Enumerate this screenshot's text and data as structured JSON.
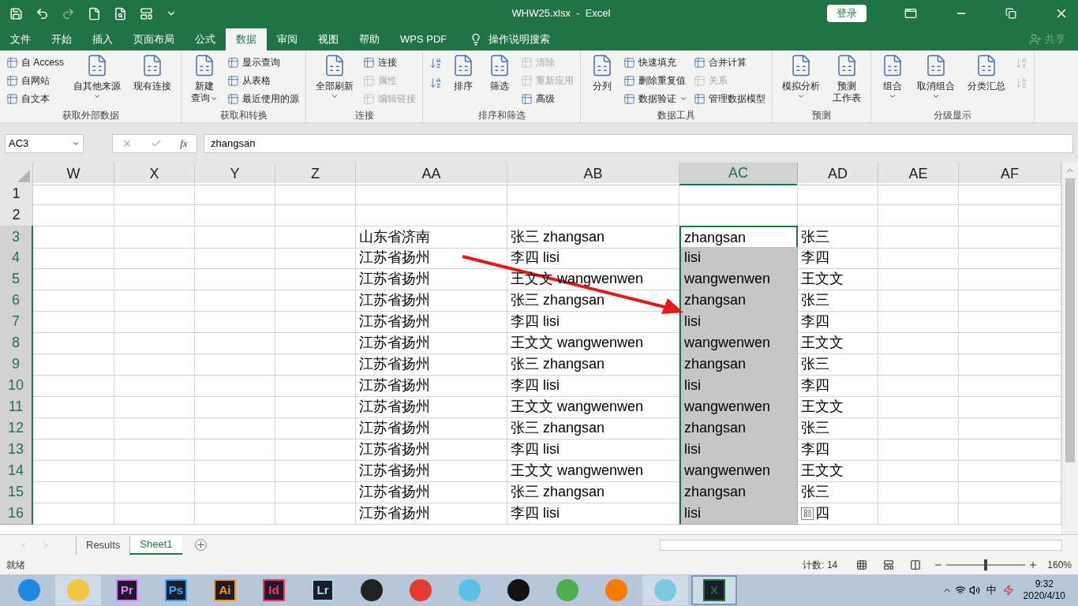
{
  "window": {
    "title": "WHW25.xlsx  -  Excel",
    "login": "登录"
  },
  "tabs": [
    {
      "label": "文件",
      "selected": false
    },
    {
      "label": "开始",
      "selected": false
    },
    {
      "label": "插入",
      "selected": false
    },
    {
      "label": "页面布局",
      "selected": false
    },
    {
      "label": "公式",
      "selected": false
    },
    {
      "label": "数据",
      "selected": true
    },
    {
      "label": "审阅",
      "selected": false
    },
    {
      "label": "视图",
      "selected": false
    },
    {
      "label": "帮助",
      "selected": false
    },
    {
      "label": "WPS PDF",
      "selected": false
    }
  ],
  "tell_me": "操作说明搜索",
  "share": "共享",
  "ribbon_groups": [
    {
      "title": "获取外部数据",
      "columns": [
        [
          {
            "kind": "small",
            "label": "自 Access",
            "disabled": false
          },
          {
            "kind": "small",
            "label": "自网站",
            "disabled": false
          },
          {
            "kind": "small",
            "label": "自文本",
            "disabled": false
          }
        ],
        [
          {
            "kind": "large",
            "label": "自其他来源",
            "dropdown": true,
            "disabled": false
          }
        ],
        [
          {
            "kind": "large",
            "label": "现有连接",
            "dropdown": false,
            "disabled": false
          }
        ]
      ]
    },
    {
      "title": "获取和转换",
      "columns": [
        [
          {
            "kind": "large",
            "lines": [
              "新建",
              "查询"
            ],
            "dropdown": true,
            "disabled": false
          }
        ],
        [
          {
            "kind": "small",
            "label": "显示查询",
            "disabled": false
          },
          {
            "kind": "small",
            "label": "从表格",
            "disabled": false
          },
          {
            "kind": "small",
            "label": "最近使用的源",
            "disabled": false
          }
        ]
      ]
    },
    {
      "title": "连接",
      "columns": [
        [
          {
            "kind": "large",
            "label": "全部刷新",
            "dropdown": true,
            "disabled": false
          }
        ],
        [
          {
            "kind": "small",
            "label": "连接",
            "disabled": false
          },
          {
            "kind": "small",
            "label": "属性",
            "disabled": true
          },
          {
            "kind": "small",
            "label": "编辑链接",
            "disabled": true
          }
        ]
      ]
    },
    {
      "title": "排序和筛选",
      "columns": [
        [
          {
            "kind": "icon",
            "disabled": false
          },
          {
            "kind": "icon",
            "disabled": false
          }
        ],
        [
          {
            "kind": "large",
            "label": "排序",
            "dropdown": false,
            "disabled": false
          }
        ],
        [
          {
            "kind": "large",
            "label": "筛选",
            "dropdown": false,
            "disabled": false
          }
        ],
        [
          {
            "kind": "small",
            "label": "清除",
            "disabled": true
          },
          {
            "kind": "small",
            "label": "重新应用",
            "disabled": true
          },
          {
            "kind": "small",
            "label": "高级",
            "disabled": false
          }
        ]
      ]
    },
    {
      "title": "数据工具",
      "columns": [
        [
          {
            "kind": "large",
            "label": "分列",
            "dropdown": false,
            "disabled": false
          }
        ],
        [
          {
            "kind": "small",
            "label": "快速填充",
            "disabled": false
          },
          {
            "kind": "small",
            "label": "删除重复值",
            "disabled": false
          },
          {
            "kind": "small",
            "label": "数据验证",
            "disabled": false,
            "dropdown": true
          }
        ],
        [
          {
            "kind": "small",
            "label": "合并计算",
            "disabled": false
          },
          {
            "kind": "small",
            "label": "关系",
            "disabled": true
          },
          {
            "kind": "small",
            "label": "管理数据模型",
            "disabled": false
          }
        ]
      ]
    },
    {
      "title": "预测",
      "columns": [
        [
          {
            "kind": "large",
            "label": "模拟分析",
            "dropdown": true,
            "disabled": false
          }
        ],
        [
          {
            "kind": "large",
            "lines": [
              "预测",
              "工作表"
            ],
            "dropdown": false,
            "disabled": false
          }
        ]
      ]
    },
    {
      "title": "分级显示",
      "columns": [
        [
          {
            "kind": "large",
            "label": "组合",
            "dropdown": true,
            "disabled": false
          }
        ],
        [
          {
            "kind": "large",
            "label": "取消组合",
            "dropdown": true,
            "disabled": false
          }
        ],
        [
          {
            "kind": "large",
            "label": "分类汇总",
            "dropdown": false,
            "disabled": false
          }
        ],
        [
          {
            "kind": "icon",
            "disabled": true
          },
          {
            "kind": "icon",
            "disabled": true
          }
        ]
      ]
    }
  ],
  "formula_bar": {
    "name_box": "AC3",
    "fx": "fx",
    "value": "zhangsan"
  },
  "columns": [
    {
      "label": "W",
      "selected": false
    },
    {
      "label": "X",
      "selected": false
    },
    {
      "label": "Y",
      "selected": false
    },
    {
      "label": "Z",
      "selected": false
    },
    {
      "label": "AA",
      "selected": false
    },
    {
      "label": "AB",
      "selected": false
    },
    {
      "label": "AC",
      "selected": true
    },
    {
      "label": "AD",
      "selected": false
    },
    {
      "label": "AE",
      "selected": false
    },
    {
      "label": "AF",
      "selected": false
    }
  ],
  "rows": [
    {
      "number": "1",
      "selected": false,
      "cells": [
        {
          "selected": false
        },
        {
          "selected": false
        },
        {
          "selected": false
        },
        {
          "selected": false
        },
        {
          "selected": false
        },
        {
          "selected": false
        },
        {
          "selected": false,
          "active": false
        },
        {
          "selected": false
        },
        {
          "selected": false
        },
        {
          "selected": false
        }
      ]
    },
    {
      "number": "2",
      "selected": false,
      "cells": [
        {
          "selected": false
        },
        {
          "selected": false
        },
        {
          "selected": false
        },
        {
          "selected": false
        },
        {
          "selected": false
        },
        {
          "selected": false
        },
        {
          "selected": false,
          "active": false
        },
        {
          "selected": false
        },
        {
          "selected": false
        },
        {
          "selected": false
        }
      ]
    },
    {
      "number": "3",
      "selected": true,
      "cells": [
        {
          "selected": false
        },
        {
          "selected": false
        },
        {
          "selected": false
        },
        {
          "selected": false
        },
        {
          "text": "山东省济南",
          "selected": false
        },
        {
          "text": "张三 zhangsan",
          "selected": false
        },
        {
          "text": "zhangsan",
          "selected": true,
          "active": true
        },
        {
          "text": "张三",
          "selected": false
        },
        {
          "selected": false
        },
        {
          "selected": false
        }
      ]
    },
    {
      "number": "4",
      "selected": true,
      "cells": [
        {
          "selected": false
        },
        {
          "selected": false
        },
        {
          "selected": false
        },
        {
          "selected": false
        },
        {
          "text": "江苏省扬州",
          "selected": false
        },
        {
          "text": "李四 lisi",
          "selected": false
        },
        {
          "text": "lisi",
          "selected": true,
          "active": false
        },
        {
          "text": "李四",
          "selected": false
        },
        {
          "selected": false
        },
        {
          "selected": false
        }
      ]
    },
    {
      "number": "5",
      "selected": true,
      "cells": [
        {
          "selected": false
        },
        {
          "selected": false
        },
        {
          "selected": false
        },
        {
          "selected": false
        },
        {
          "text": "江苏省扬州",
          "selected": false
        },
        {
          "text": "王文文 wangwenwen",
          "selected": false
        },
        {
          "text": "wangwenwen",
          "selected": true,
          "active": false
        },
        {
          "text": "王文文",
          "selected": false
        },
        {
          "selected": false
        },
        {
          "selected": false
        }
      ]
    },
    {
      "number": "6",
      "selected": true,
      "cells": [
        {
          "selected": false
        },
        {
          "selected": false
        },
        {
          "selected": false
        },
        {
          "selected": false
        },
        {
          "text": "江苏省扬州",
          "selected": false
        },
        {
          "text": "张三 zhangsan",
          "selected": false
        },
        {
          "text": "zhangsan",
          "selected": true,
          "active": false
        },
        {
          "text": "张三",
          "selected": false
        },
        {
          "selected": false
        },
        {
          "selected": false
        }
      ]
    },
    {
      "number": "7",
      "selected": true,
      "cells": [
        {
          "selected": false
        },
        {
          "selected": false
        },
        {
          "selected": false
        },
        {
          "selected": false
        },
        {
          "text": "江苏省扬州",
          "selected": false
        },
        {
          "text": "李四 lisi",
          "selected": false
        },
        {
          "text": "lisi",
          "selected": true,
          "active": false
        },
        {
          "text": "李四",
          "selected": false
        },
        {
          "selected": false
        },
        {
          "selected": false
        }
      ]
    },
    {
      "number": "8",
      "selected": true,
      "cells": [
        {
          "selected": false
        },
        {
          "selected": false
        },
        {
          "selected": false
        },
        {
          "selected": false
        },
        {
          "text": "江苏省扬州",
          "selected": false
        },
        {
          "text": "王文文 wangwenwen",
          "selected": false
        },
        {
          "text": "wangwenwen",
          "selected": true,
          "active": false
        },
        {
          "text": "王文文",
          "selected": false
        },
        {
          "selected": false
        },
        {
          "selected": false
        }
      ]
    },
    {
      "number": "9",
      "selected": true,
      "cells": [
        {
          "selected": false
        },
        {
          "selected": false
        },
        {
          "selected": false
        },
        {
          "selected": false
        },
        {
          "text": "江苏省扬州",
          "selected": false
        },
        {
          "text": "张三 zhangsan",
          "selected": false
        },
        {
          "text": "zhangsan",
          "selected": true,
          "active": false
        },
        {
          "text": "张三",
          "selected": false
        },
        {
          "selected": false
        },
        {
          "selected": false
        }
      ]
    },
    {
      "number": "10",
      "selected": true,
      "cells": [
        {
          "selected": false
        },
        {
          "selected": false
        },
        {
          "selected": false
        },
        {
          "selected": false
        },
        {
          "text": "江苏省扬州",
          "selected": false
        },
        {
          "text": "李四 lisi",
          "selected": false
        },
        {
          "text": "lisi",
          "selected": true,
          "active": false
        },
        {
          "text": "李四",
          "selected": false
        },
        {
          "selected": false
        },
        {
          "selected": false
        }
      ]
    },
    {
      "number": "11",
      "selected": true,
      "cells": [
        {
          "selected": false
        },
        {
          "selected": false
        },
        {
          "selected": false
        },
        {
          "selected": false
        },
        {
          "text": "江苏省扬州",
          "selected": false
        },
        {
          "text": "王文文 wangwenwen",
          "selected": false
        },
        {
          "text": "wangwenwen",
          "selected": true,
          "active": false
        },
        {
          "text": "王文文",
          "selected": false
        },
        {
          "selected": false
        },
        {
          "selected": false
        }
      ]
    },
    {
      "number": "12",
      "selected": true,
      "cells": [
        {
          "selected": false
        },
        {
          "selected": false
        },
        {
          "selected": false
        },
        {
          "selected": false
        },
        {
          "text": "江苏省扬州",
          "selected": false
        },
        {
          "text": "张三 zhangsan",
          "selected": false
        },
        {
          "text": "zhangsan",
          "selected": true,
          "active": false
        },
        {
          "text": "张三",
          "selected": false
        },
        {
          "selected": false
        },
        {
          "selected": false
        }
      ]
    },
    {
      "number": "13",
      "selected": true,
      "cells": [
        {
          "selected": false
        },
        {
          "selected": false
        },
        {
          "selected": false
        },
        {
          "selected": false
        },
        {
          "text": "江苏省扬州",
          "selected": false
        },
        {
          "text": "李四 lisi",
          "selected": false
        },
        {
          "text": "lisi",
          "selected": true,
          "active": false
        },
        {
          "text": "李四",
          "selected": false
        },
        {
          "selected": false
        },
        {
          "selected": false
        }
      ]
    },
    {
      "number": "14",
      "selected": true,
      "cells": [
        {
          "selected": false
        },
        {
          "selected": false
        },
        {
          "selected": false
        },
        {
          "selected": false
        },
        {
          "text": "江苏省扬州",
          "selected": false
        },
        {
          "text": "王文文 wangwenwen",
          "selected": false
        },
        {
          "text": "wangwenwen",
          "selected": true,
          "active": false
        },
        {
          "text": "王文文",
          "selected": false
        },
        {
          "selected": false
        },
        {
          "selected": false
        }
      ]
    },
    {
      "number": "15",
      "selected": true,
      "cells": [
        {
          "selected": false
        },
        {
          "selected": false
        },
        {
          "selected": false
        },
        {
          "selected": false
        },
        {
          "text": "江苏省扬州",
          "selected": false
        },
        {
          "text": "张三 zhangsan",
          "selected": false
        },
        {
          "text": "zhangsan",
          "selected": true,
          "active": false
        },
        {
          "text": "张三",
          "selected": false
        },
        {
          "selected": false
        },
        {
          "selected": false
        }
      ]
    },
    {
      "number": "16",
      "selected": true,
      "cells": [
        {
          "selected": false
        },
        {
          "selected": false
        },
        {
          "selected": false
        },
        {
          "selected": false
        },
        {
          "text": "江苏省扬州",
          "selected": false
        },
        {
          "text": "李四 lisi",
          "selected": false
        },
        {
          "text": "lisi",
          "selected": true,
          "active": false
        },
        {
          "text": "四",
          "selected": false,
          "quick_analysis": true
        },
        {
          "selected": false
        },
        {
          "selected": false
        }
      ]
    }
  ],
  "sheet_tabs": [
    {
      "label": "Results",
      "selected": false
    },
    {
      "label": "Sheet1",
      "selected": true
    }
  ],
  "status_bar": {
    "status": "就绪",
    "count": "计数: 14",
    "zoom": "160%",
    "zoom_level": {
      "level": 0.5
    }
  },
  "taskbar": {
    "apps": [
      {
        "kind": "icon",
        "color": "#1e88e5",
        "selected": false,
        "open": false
      },
      {
        "kind": "icon",
        "color": "#f4c542",
        "selected": false,
        "open": true
      },
      {
        "kind": "text",
        "label": "Pr",
        "color": "#ea77ff",
        "selected": false,
        "open": false
      },
      {
        "kind": "text",
        "label": "Ps",
        "color": "#31a8ff",
        "selected": false,
        "open": false
      },
      {
        "kind": "text",
        "label": "Ai",
        "color": "#ff9a00",
        "selected": false,
        "open": false
      },
      {
        "kind": "text",
        "label": "Id",
        "color": "#ff3366",
        "selected": false,
        "open": false
      },
      {
        "kind": "text",
        "label": "Lr",
        "color": "#add5ec",
        "selected": false,
        "open": false
      },
      {
        "kind": "icon",
        "color": "#222222",
        "selected": false,
        "open": false
      },
      {
        "kind": "icon",
        "color": "#e53935",
        "selected": false,
        "open": false
      },
      {
        "kind": "icon",
        "color": "#5bc0eb",
        "selected": false,
        "open": false
      },
      {
        "kind": "icon",
        "color": "#111111",
        "selected": false,
        "open": false
      },
      {
        "kind": "icon",
        "color": "#4caf50",
        "selected": false,
        "open": false
      },
      {
        "kind": "icon",
        "color": "#f57c00",
        "selected": false,
        "open": false
      },
      {
        "kind": "icon",
        "color": "#7ec8e3",
        "selected": false,
        "open": true
      },
      {
        "kind": "text",
        "label": "X",
        "color": "#1d6f42",
        "selected": true,
        "open": true
      }
    ],
    "ime": "中",
    "time": "9:32",
    "date": "2020/4/10"
  }
}
